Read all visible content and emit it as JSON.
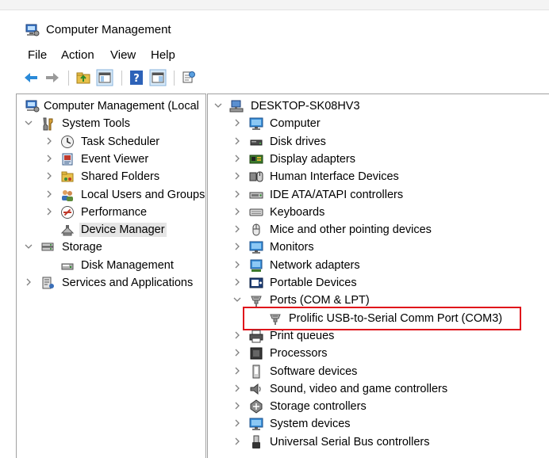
{
  "window": {
    "title": "Computer Management"
  },
  "menu": [
    "File",
    "Action",
    "View",
    "Help"
  ],
  "toolbar": {
    "icons": [
      "back-arrow-icon",
      "forward-arrow-icon",
      "up-folder-icon",
      "console-tree-icon",
      "help-icon",
      "action-pane-icon",
      "properties-icon"
    ]
  },
  "left_tree": [
    {
      "label": "Computer Management (Local",
      "icon": "computer-management-icon",
      "level": 0,
      "expander": "none"
    },
    {
      "label": "System Tools",
      "icon": "system-tools-icon",
      "level": 1,
      "expander": "expanded"
    },
    {
      "label": "Task Scheduler",
      "icon": "clock-icon",
      "level": 2,
      "expander": "collapsed"
    },
    {
      "label": "Event Viewer",
      "icon": "event-viewer-icon",
      "level": 2,
      "expander": "collapsed"
    },
    {
      "label": "Shared Folders",
      "icon": "shared-folder-icon",
      "level": 2,
      "expander": "collapsed"
    },
    {
      "label": "Local Users and Groups",
      "icon": "users-icon",
      "level": 2,
      "expander": "collapsed"
    },
    {
      "label": "Performance",
      "icon": "performance-icon",
      "level": 2,
      "expander": "collapsed"
    },
    {
      "label": "Device Manager",
      "icon": "device-manager-icon",
      "level": 2,
      "expander": "none",
      "selected": true
    },
    {
      "label": "Storage",
      "icon": "storage-icon",
      "level": 1,
      "expander": "expanded"
    },
    {
      "label": "Disk Management",
      "icon": "disk-management-icon",
      "level": 2,
      "expander": "none"
    },
    {
      "label": "Services and Applications",
      "icon": "services-icon",
      "level": 1,
      "expander": "collapsed"
    }
  ],
  "right_tree": {
    "root": {
      "label": "DESKTOP-SK08HV3",
      "icon": "computer-network-icon",
      "expander": "expanded"
    },
    "categories": [
      {
        "label": "Computer",
        "icon": "monitor-icon",
        "expander": "collapsed"
      },
      {
        "label": "Disk drives",
        "icon": "disk-drive-icon",
        "expander": "collapsed"
      },
      {
        "label": "Display adapters",
        "icon": "display-adapter-icon",
        "expander": "collapsed"
      },
      {
        "label": "Human Interface Devices",
        "icon": "hid-icon",
        "expander": "collapsed"
      },
      {
        "label": "IDE ATA/ATAPI controllers",
        "icon": "ide-controller-icon",
        "expander": "collapsed"
      },
      {
        "label": "Keyboards",
        "icon": "keyboard-icon",
        "expander": "collapsed"
      },
      {
        "label": "Mice and other pointing devices",
        "icon": "mouse-icon",
        "expander": "collapsed"
      },
      {
        "label": "Monitors",
        "icon": "monitor-icon",
        "expander": "collapsed"
      },
      {
        "label": "Network adapters",
        "icon": "network-adapter-icon",
        "expander": "collapsed"
      },
      {
        "label": "Portable Devices",
        "icon": "portable-device-icon",
        "expander": "collapsed"
      },
      {
        "label": "Ports (COM & LPT)",
        "icon": "port-icon",
        "expander": "expanded",
        "children": [
          {
            "label": "Prolific USB-to-Serial Comm Port (COM3)",
            "icon": "port-icon",
            "highlighted": true
          }
        ]
      },
      {
        "label": "Print queues",
        "icon": "printer-icon",
        "expander": "collapsed"
      },
      {
        "label": "Processors",
        "icon": "processor-icon",
        "expander": "collapsed"
      },
      {
        "label": "Software devices",
        "icon": "software-device-icon",
        "expander": "collapsed"
      },
      {
        "label": "Sound, video and game controllers",
        "icon": "speaker-icon",
        "expander": "collapsed"
      },
      {
        "label": "Storage controllers",
        "icon": "storage-controller-icon",
        "expander": "collapsed"
      },
      {
        "label": "System devices",
        "icon": "monitor-icon",
        "expander": "collapsed"
      },
      {
        "label": "Universal Serial Bus controllers",
        "icon": "usb-icon",
        "expander": "collapsed"
      }
    ]
  },
  "colors": {
    "selection_gray": "#e5e5e5",
    "highlight_blue": "#cce8ff",
    "annotation_red": "#e0131b",
    "chevron_gray": "#808080"
  }
}
